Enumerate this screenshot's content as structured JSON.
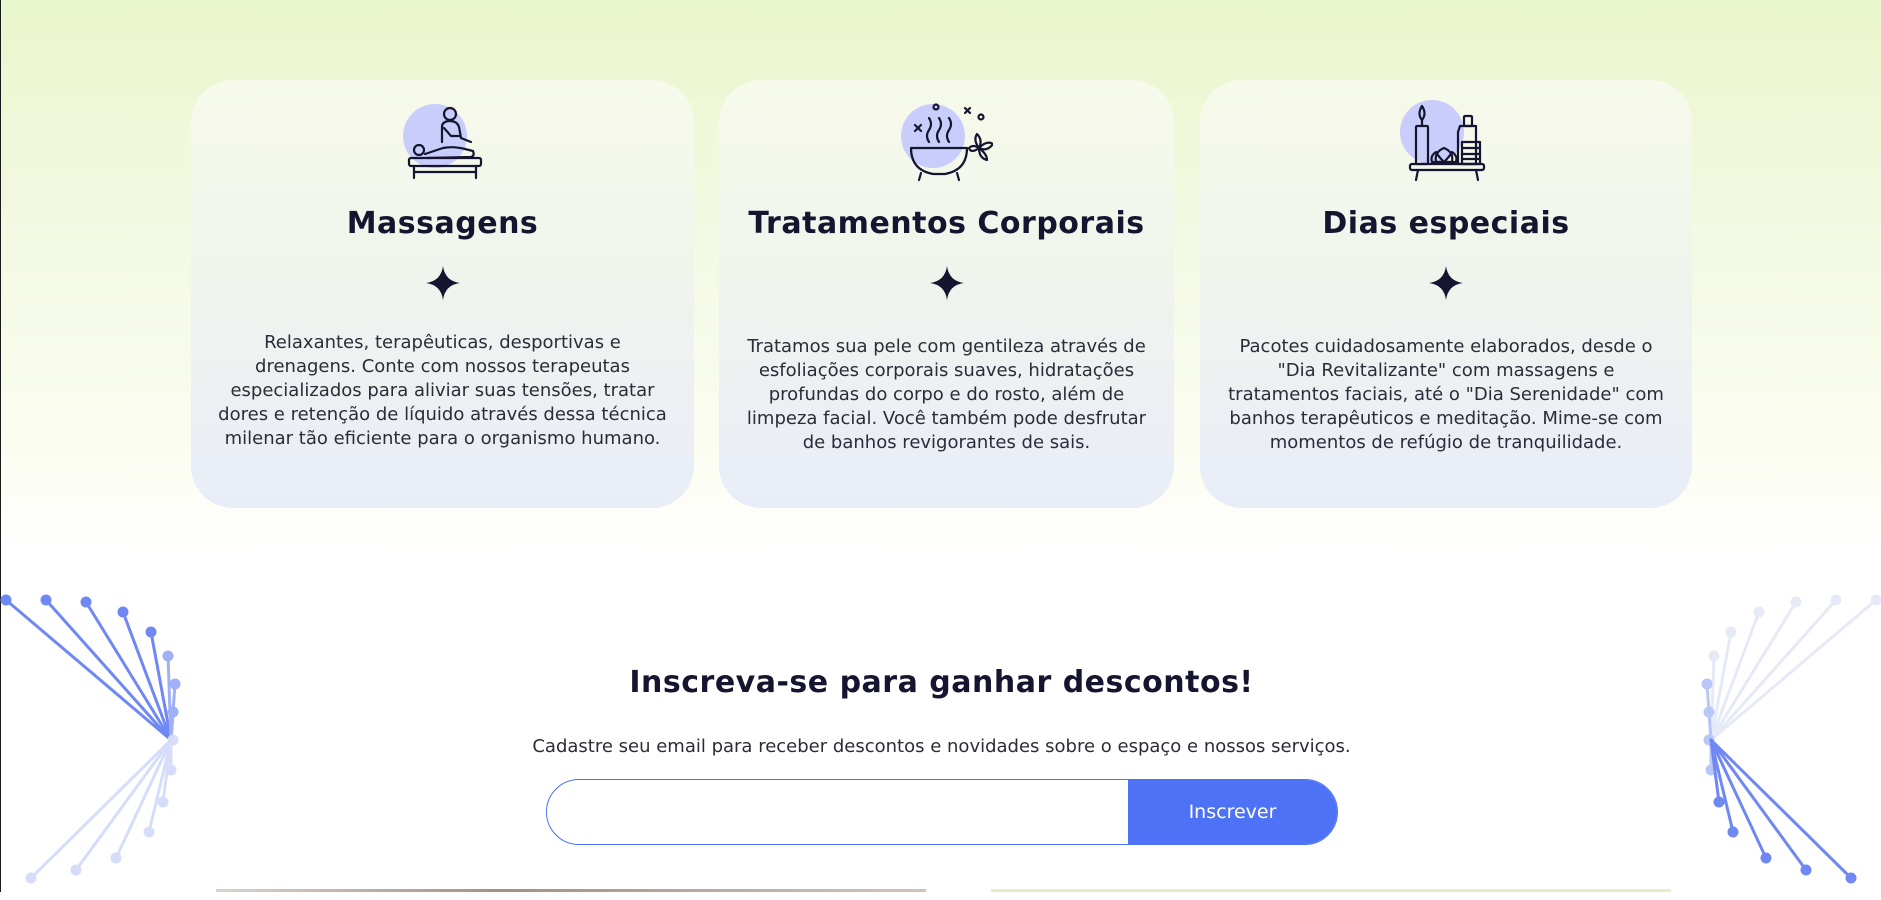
{
  "services": {
    "cards": [
      {
        "title": "Massagens",
        "icon": "massage-icon",
        "description": "Relaxantes, terapêuticas, desportivas e drenagens. Conte com nossos terapeutas especializados para aliviar suas tensões, tratar dores e retenção de líquido através dessa técnica milenar tão eficiente para o organismo humano."
      },
      {
        "title": "Tratamentos Corporais",
        "icon": "bathtub-icon",
        "description": "Tratamos sua pele com gentileza através de esfoliações corporais suaves, hidratações profundas do corpo e do rosto, além de limpeza facial. Você também pode desfrutar de banhos revigorantes de sais."
      },
      {
        "title": "Dias especiais",
        "icon": "spa-kit-icon",
        "description": "Pacotes cuidadosamente elaborados, desde o \"Dia Revitalizante\" com massagens e tratamentos faciais, até o \"Dia Serenidade\" com banhos terapêuticos e meditação. Mime-se com momentos de refúgio de tranquilidade."
      }
    ]
  },
  "subscribe": {
    "title": "Inscreva-se para ganhar descontos!",
    "text": "Cadastre seu email para receber descontos e novidades sobre o espaço e nossos serviços.",
    "email_placeholder": "",
    "button_label": "Inscrever"
  },
  "colors": {
    "accent": "#4d72f5",
    "icon_circle": "#c9cdfb",
    "heading": "#15152f",
    "top_background": "#eaf6cc"
  }
}
